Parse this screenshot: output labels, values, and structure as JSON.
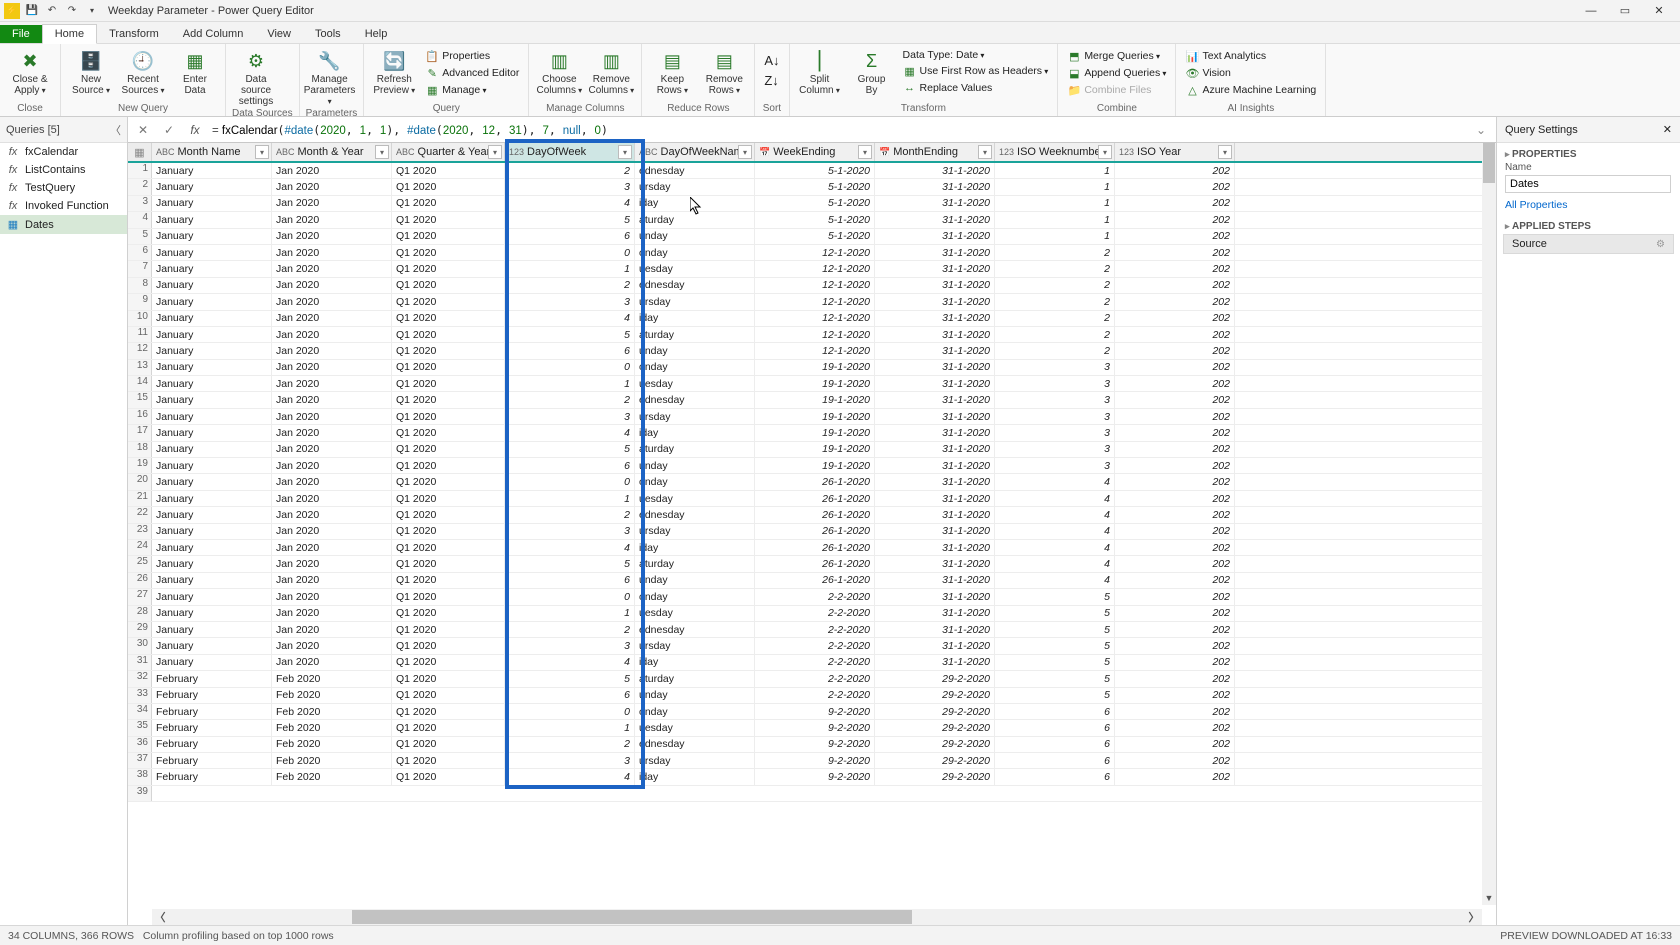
{
  "window": {
    "title": "Weekday Parameter - Power Query Editor"
  },
  "tabs": {
    "file": "File",
    "home": "Home",
    "transform": "Transform",
    "addcol": "Add Column",
    "view": "View",
    "tools": "Tools",
    "help": "Help"
  },
  "ribbon": {
    "close_apply": "Close &\nApply",
    "new_source": "New\nSource",
    "recent_sources": "Recent\nSources",
    "enter_data": "Enter\nData",
    "data_source": "Data source\nsettings",
    "manage_params": "Manage\nParameters",
    "refresh": "Refresh\nPreview",
    "properties": "Properties",
    "adv_editor": "Advanced Editor",
    "manage": "Manage",
    "choose_cols": "Choose\nColumns",
    "remove_cols": "Remove\nColumns",
    "keep_rows": "Keep\nRows",
    "remove_rows": "Remove\nRows",
    "split": "Split\nColumn",
    "group": "Group\nBy",
    "data_type": "Data Type: Date",
    "first_row": "Use First Row as Headers",
    "replace": "Replace Values",
    "merge": "Merge Queries",
    "append": "Append Queries",
    "combine_files": "Combine Files",
    "text_an": "Text Analytics",
    "vision": "Vision",
    "azure_ml": "Azure Machine Learning",
    "g_close": "Close",
    "g_newq": "New Query",
    "g_ds": "Data Sources",
    "g_param": "Parameters",
    "g_query": "Query",
    "g_mc": "Manage Columns",
    "g_rr": "Reduce Rows",
    "g_sort": "Sort",
    "g_tr": "Transform",
    "g_comb": "Combine",
    "g_ai": "AI Insights"
  },
  "formula": {
    "fn": "fxCalendar",
    "d1": "#date",
    "y1": "2020",
    "m1": "1",
    "dd1": "1",
    "y2": "2020",
    "m2": "12",
    "dd2": "31",
    "p1": "7",
    "p2": "null",
    "p3": "0"
  },
  "queries": {
    "title": "Queries [5]",
    "items": [
      {
        "icon": "fx",
        "label": "fxCalendar"
      },
      {
        "icon": "fx",
        "label": "ListContains"
      },
      {
        "icon": "fx",
        "label": "TestQuery"
      },
      {
        "icon": "fx",
        "label": "Invoked Function"
      },
      {
        "icon": "tbl",
        "label": "Dates",
        "sel": true
      }
    ]
  },
  "columns": [
    {
      "name": "Month Name",
      "type": "ABC",
      "cls": "c0",
      "align": "text"
    },
    {
      "name": "Month & Year",
      "type": "ABC",
      "cls": "c1",
      "align": "text"
    },
    {
      "name": "Quarter & Year",
      "type": "ABC",
      "cls": "c2",
      "align": "text"
    },
    {
      "name": "DayOfWeek",
      "type": "123",
      "cls": "c3",
      "align": "num",
      "sel": true
    },
    {
      "name": "DayOfWeekName",
      "type": "ABC",
      "cls": "c4",
      "align": "text"
    },
    {
      "name": "WeekEnding",
      "type": "📅",
      "cls": "c5",
      "align": "date"
    },
    {
      "name": "MonthEnding",
      "type": "📅",
      "cls": "c6",
      "align": "date"
    },
    {
      "name": "ISO Weeknumber",
      "type": "123",
      "cls": "c7",
      "align": "num"
    },
    {
      "name": "ISO Year",
      "type": "123",
      "cls": "c8",
      "align": "num"
    }
  ],
  "rows": [
    [
      "January",
      "Jan 2020",
      "Q1 2020",
      "2",
      "ednesday",
      "5-1-2020",
      "31-1-2020",
      "1",
      "202"
    ],
    [
      "January",
      "Jan 2020",
      "Q1 2020",
      "3",
      "ursday",
      "5-1-2020",
      "31-1-2020",
      "1",
      "202"
    ],
    [
      "January",
      "Jan 2020",
      "Q1 2020",
      "4",
      "iday",
      "5-1-2020",
      "31-1-2020",
      "1",
      "202"
    ],
    [
      "January",
      "Jan 2020",
      "Q1 2020",
      "5",
      "aturday",
      "5-1-2020",
      "31-1-2020",
      "1",
      "202"
    ],
    [
      "January",
      "Jan 2020",
      "Q1 2020",
      "6",
      "unday",
      "5-1-2020",
      "31-1-2020",
      "1",
      "202"
    ],
    [
      "January",
      "Jan 2020",
      "Q1 2020",
      "0",
      "onday",
      "12-1-2020",
      "31-1-2020",
      "2",
      "202"
    ],
    [
      "January",
      "Jan 2020",
      "Q1 2020",
      "1",
      "uesday",
      "12-1-2020",
      "31-1-2020",
      "2",
      "202"
    ],
    [
      "January",
      "Jan 2020",
      "Q1 2020",
      "2",
      "ednesday",
      "12-1-2020",
      "31-1-2020",
      "2",
      "202"
    ],
    [
      "January",
      "Jan 2020",
      "Q1 2020",
      "3",
      "ursday",
      "12-1-2020",
      "31-1-2020",
      "2",
      "202"
    ],
    [
      "January",
      "Jan 2020",
      "Q1 2020",
      "4",
      "iday",
      "12-1-2020",
      "31-1-2020",
      "2",
      "202"
    ],
    [
      "January",
      "Jan 2020",
      "Q1 2020",
      "5",
      "aturday",
      "12-1-2020",
      "31-1-2020",
      "2",
      "202"
    ],
    [
      "January",
      "Jan 2020",
      "Q1 2020",
      "6",
      "unday",
      "12-1-2020",
      "31-1-2020",
      "2",
      "202"
    ],
    [
      "January",
      "Jan 2020",
      "Q1 2020",
      "0",
      "onday",
      "19-1-2020",
      "31-1-2020",
      "3",
      "202"
    ],
    [
      "January",
      "Jan 2020",
      "Q1 2020",
      "1",
      "uesday",
      "19-1-2020",
      "31-1-2020",
      "3",
      "202"
    ],
    [
      "January",
      "Jan 2020",
      "Q1 2020",
      "2",
      "ednesday",
      "19-1-2020",
      "31-1-2020",
      "3",
      "202"
    ],
    [
      "January",
      "Jan 2020",
      "Q1 2020",
      "3",
      "ursday",
      "19-1-2020",
      "31-1-2020",
      "3",
      "202"
    ],
    [
      "January",
      "Jan 2020",
      "Q1 2020",
      "4",
      "iday",
      "19-1-2020",
      "31-1-2020",
      "3",
      "202"
    ],
    [
      "January",
      "Jan 2020",
      "Q1 2020",
      "5",
      "aturday",
      "19-1-2020",
      "31-1-2020",
      "3",
      "202"
    ],
    [
      "January",
      "Jan 2020",
      "Q1 2020",
      "6",
      "unday",
      "19-1-2020",
      "31-1-2020",
      "3",
      "202"
    ],
    [
      "January",
      "Jan 2020",
      "Q1 2020",
      "0",
      "onday",
      "26-1-2020",
      "31-1-2020",
      "4",
      "202"
    ],
    [
      "January",
      "Jan 2020",
      "Q1 2020",
      "1",
      "uesday",
      "26-1-2020",
      "31-1-2020",
      "4",
      "202"
    ],
    [
      "January",
      "Jan 2020",
      "Q1 2020",
      "2",
      "ednesday",
      "26-1-2020",
      "31-1-2020",
      "4",
      "202"
    ],
    [
      "January",
      "Jan 2020",
      "Q1 2020",
      "3",
      "ursday",
      "26-1-2020",
      "31-1-2020",
      "4",
      "202"
    ],
    [
      "January",
      "Jan 2020",
      "Q1 2020",
      "4",
      "iday",
      "26-1-2020",
      "31-1-2020",
      "4",
      "202"
    ],
    [
      "January",
      "Jan 2020",
      "Q1 2020",
      "5",
      "aturday",
      "26-1-2020",
      "31-1-2020",
      "4",
      "202"
    ],
    [
      "January",
      "Jan 2020",
      "Q1 2020",
      "6",
      "unday",
      "26-1-2020",
      "31-1-2020",
      "4",
      "202"
    ],
    [
      "January",
      "Jan 2020",
      "Q1 2020",
      "0",
      "onday",
      "2-2-2020",
      "31-1-2020",
      "5",
      "202"
    ],
    [
      "January",
      "Jan 2020",
      "Q1 2020",
      "1",
      "uesday",
      "2-2-2020",
      "31-1-2020",
      "5",
      "202"
    ],
    [
      "January",
      "Jan 2020",
      "Q1 2020",
      "2",
      "ednesday",
      "2-2-2020",
      "31-1-2020",
      "5",
      "202"
    ],
    [
      "January",
      "Jan 2020",
      "Q1 2020",
      "3",
      "ursday",
      "2-2-2020",
      "31-1-2020",
      "5",
      "202"
    ],
    [
      "January",
      "Jan 2020",
      "Q1 2020",
      "4",
      "iday",
      "2-2-2020",
      "31-1-2020",
      "5",
      "202"
    ],
    [
      "February",
      "Feb 2020",
      "Q1 2020",
      "5",
      "aturday",
      "2-2-2020",
      "29-2-2020",
      "5",
      "202"
    ],
    [
      "February",
      "Feb 2020",
      "Q1 2020",
      "6",
      "unday",
      "2-2-2020",
      "29-2-2020",
      "5",
      "202"
    ],
    [
      "February",
      "Feb 2020",
      "Q1 2020",
      "0",
      "onday",
      "9-2-2020",
      "29-2-2020",
      "6",
      "202"
    ],
    [
      "February",
      "Feb 2020",
      "Q1 2020",
      "1",
      "uesday",
      "9-2-2020",
      "29-2-2020",
      "6",
      "202"
    ],
    [
      "February",
      "Feb 2020",
      "Q1 2020",
      "2",
      "ednesday",
      "9-2-2020",
      "29-2-2020",
      "6",
      "202"
    ],
    [
      "February",
      "Feb 2020",
      "Q1 2020",
      "3",
      "ursday",
      "9-2-2020",
      "29-2-2020",
      "6",
      "202"
    ],
    [
      "February",
      "Feb 2020",
      "Q1 2020",
      "4",
      "iday",
      "9-2-2020",
      "29-2-2020",
      "6",
      "202"
    ]
  ],
  "settings": {
    "title": "Query Settings",
    "props_h": "PROPERTIES",
    "name_lbl": "Name",
    "name_val": "Dates",
    "all_props": "All Properties",
    "steps_h": "APPLIED STEPS",
    "step1": "Source"
  },
  "status": {
    "left": "34 COLUMNS, 366 ROWS",
    "mid": "Column profiling based on top 1000 rows",
    "right": "PREVIEW DOWNLOADED AT 16:33"
  }
}
